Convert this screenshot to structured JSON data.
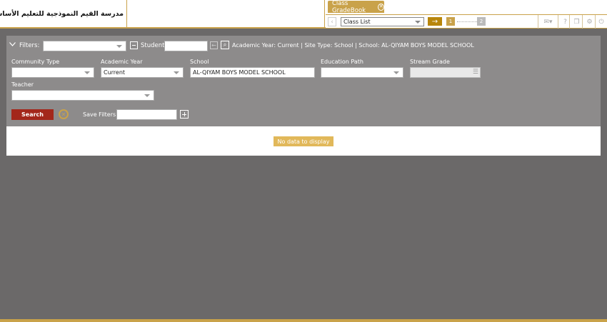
{
  "header": {
    "school_name": "مدرسة القيم النموذجية للتعليم الأساسي للبنين"
  },
  "tabs": [
    {
      "label": "Class GradeBook",
      "close_icon": "close-icon"
    }
  ],
  "toolbar": {
    "list_value": "Class List",
    "go_icon": "arrow-right-icon",
    "step1": "1",
    "step2": "2",
    "icons": [
      "mail-icon",
      "help-icon",
      "copy-icon",
      "user-settings-icon",
      "power-icon"
    ]
  },
  "filters": {
    "label": "Filters:",
    "student_label": "Student",
    "summary": "Academic Year: Current | Site Type: School | School: AL-QIYAM BOYS MODEL SCHOOL",
    "fields": {
      "community_type": {
        "label": "Community Type",
        "value": ""
      },
      "academic_year": {
        "label": "Academic Year",
        "value": "Current"
      },
      "school": {
        "label": "School",
        "value": "AL-QIYAM BOYS MODEL SCHOOL"
      },
      "education_path": {
        "label": "Education Path",
        "value": ""
      },
      "stream_grade": {
        "label": "Stream Grade",
        "value": ""
      },
      "teacher": {
        "label": "Teacher",
        "value": ""
      }
    },
    "search_label": "Search",
    "save_filters_label": "Save Filters"
  },
  "results": {
    "empty_message": "No data to display"
  },
  "colors": {
    "accent": "#c9a24a",
    "panel_bg": "#8d8b8b",
    "page_bg": "#6b6969",
    "search_button": "#a3271b",
    "nodata_badge": "#e1b85a"
  }
}
